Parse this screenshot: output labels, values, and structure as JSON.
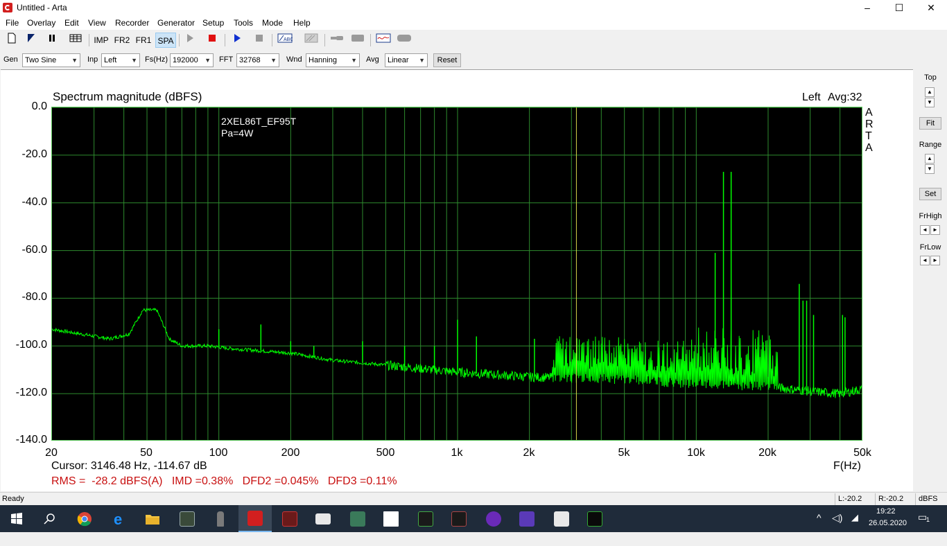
{
  "window": {
    "title": "Untitled - Arta",
    "minimize": "–",
    "maximize": "☐",
    "close": "✕"
  },
  "menu": [
    "File",
    "Overlay",
    "Edit",
    "View",
    "Recorder",
    "Generator",
    "Setup",
    "Tools",
    "Mode",
    "Help"
  ],
  "toolbar": {
    "imp": "IMP",
    "fr2": "FR2",
    "fr1": "FR1",
    "spa": "SPA"
  },
  "options": {
    "gen_label": "Gen",
    "gen_value": "Two Sine",
    "inp_label": "Inp",
    "inp_value": "Left",
    "fs_label": "Fs(Hz)",
    "fs_value": "192000",
    "fft_label": "FFT",
    "fft_value": "32768",
    "wnd_label": "Wnd",
    "wnd_value": "Hanning",
    "avg_label": "Avg",
    "avg_value": "Linear",
    "reset_label": "Reset"
  },
  "plot": {
    "title": "Spectrum magnitude (dBFS)",
    "channel": "Left",
    "avg": "Avg:32",
    "annotation_1": "2XEL86T_EF95T",
    "annotation_2": "Pa=4W",
    "watermark": [
      "A",
      "R",
      "T",
      "A"
    ],
    "cursor_readout": "Cursor: 3146.48 Hz, -114.67 dB",
    "measurements": "RMS =  -28.2 dBFS(A)   IMD =0.38%   DFD2 =0.045%   DFD3 =0.11%",
    "x_unit": "F(Hz)",
    "cursor_hz": 3146.48,
    "cursor_db": -114.67
  },
  "chart_data": {
    "type": "line",
    "title": "Spectrum magnitude (dBFS)",
    "xlabel": "F(Hz)",
    "ylabel": "",
    "xscale": "log",
    "xlim": [
      20,
      50000
    ],
    "ylim": [
      -140,
      0
    ],
    "grid": true,
    "x_ticks": [
      "20",
      "50",
      "100",
      "200",
      "500",
      "1k",
      "2k",
      "5k",
      "10k",
      "20k",
      "50k"
    ],
    "x_tick_values": [
      20,
      50,
      100,
      200,
      500,
      1000,
      2000,
      5000,
      10000,
      20000,
      50000
    ],
    "y_ticks": [
      "0.0",
      "-20.0",
      "-40.0",
      "-60.0",
      "-80.0",
      "-100.0",
      "-120.0",
      "-140.0"
    ],
    "y_tick_values": [
      0,
      -20,
      -40,
      -60,
      -80,
      -100,
      -120,
      -140
    ],
    "series": [
      {
        "color": "#00ff00",
        "noise_floor": [
          [
            20,
            -93
          ],
          [
            35,
            -97
          ],
          [
            42,
            -95
          ],
          [
            48,
            -85
          ],
          [
            55,
            -85
          ],
          [
            62,
            -97
          ],
          [
            70,
            -100
          ],
          [
            90,
            -100
          ],
          [
            110,
            -101
          ],
          [
            200,
            -103
          ],
          [
            300,
            -106
          ],
          [
            500,
            -108
          ],
          [
            1000,
            -111
          ],
          [
            2000,
            -113
          ],
          [
            5000,
            -114
          ],
          [
            10000,
            -116
          ],
          [
            20000,
            -117
          ],
          [
            30000,
            -119
          ],
          [
            40000,
            -120
          ],
          [
            50000,
            -118
          ]
        ],
        "peaks": [
          [
            100,
            -93
          ],
          [
            150,
            -91
          ],
          [
            200,
            -98
          ],
          [
            250,
            -100
          ],
          [
            400,
            -98
          ],
          [
            600,
            -100
          ],
          [
            800,
            -100
          ],
          [
            1000,
            -89
          ],
          [
            1200,
            -96
          ],
          [
            2100,
            -97
          ],
          [
            13000,
            -27
          ],
          [
            14000,
            -27
          ],
          [
            12000,
            -61
          ],
          [
            27000,
            -74
          ],
          [
            28000,
            -81
          ],
          [
            29000,
            -81
          ],
          [
            31000,
            -87
          ],
          [
            41000,
            -87
          ],
          [
            42000,
            -88
          ]
        ],
        "dense_region": [
          2500,
          22000
        ]
      }
    ]
  },
  "right_panel": {
    "top": "Top",
    "fit": "Fit",
    "range": "Range",
    "set": "Set",
    "frhigh": "FrHigh",
    "frlow": "FrLow"
  },
  "status": {
    "ready": "Ready",
    "l_level": "L:-20.2",
    "r_level": "R:-20.2",
    "unit": "dBFS"
  },
  "tray": {
    "time": "19:22",
    "date": "26.05.2020",
    "notifications": "1"
  },
  "colors": {
    "trace": "#00ff00",
    "grid": "#2e8b2e",
    "cursor": "#d8d84a",
    "measure_text": "#c81010"
  }
}
